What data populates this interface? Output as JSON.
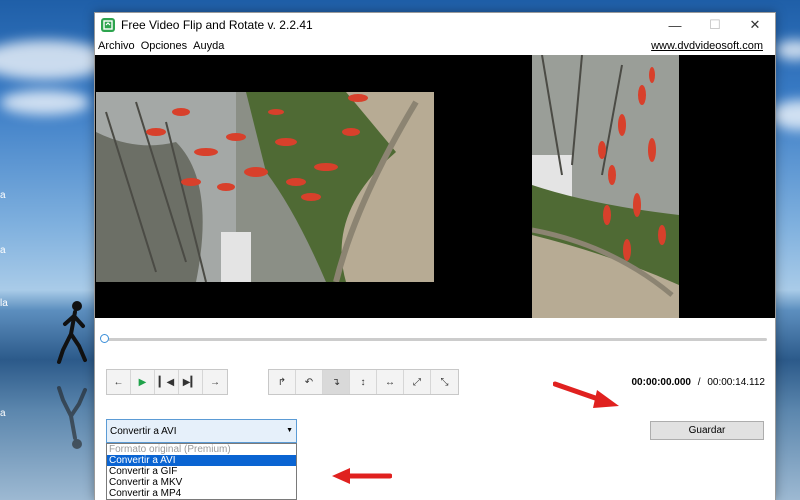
{
  "desktop": {
    "side_labels": [
      "a",
      "a",
      "la",
      "a"
    ]
  },
  "window": {
    "title": "Free Video Flip and Rotate v. 2.2.41",
    "controls": [
      "minimize",
      "maximize",
      "close"
    ]
  },
  "menu": {
    "items": [
      "Archivo",
      "Opciones",
      "Auyda"
    ],
    "site_link": "www.dvdvideosoft.com"
  },
  "playback": {
    "buttons": [
      "skip-back",
      "play",
      "prev-frame",
      "next-frame",
      "skip-forward"
    ],
    "progress": 0
  },
  "transform": {
    "buttons": [
      "rotate-left",
      "rotate-left-alt",
      "rotate-right",
      "flip-vertical",
      "flip-horizontal",
      "diagonal-1",
      "diagonal-2"
    ],
    "active_index": 2
  },
  "time": {
    "current": "00:00:00.000",
    "separator": "/",
    "total": "00:00:14.112"
  },
  "format_select": {
    "value": "Convertir a AVI",
    "options": [
      {
        "label": "Formato original (Premium)",
        "disabled": true
      },
      {
        "label": "Convertir a AVI",
        "selected": true
      },
      {
        "label": "Convertir a GIF"
      },
      {
        "label": "Convertir a MKV"
      },
      {
        "label": "Convertir a MP4"
      }
    ]
  },
  "save_button": "Guardar",
  "colors": {
    "play_green": "#1fa24a",
    "select_highlight": "#0a64d2",
    "annotation_red": "#e0211f",
    "app_icon_green": "#2da44e"
  }
}
